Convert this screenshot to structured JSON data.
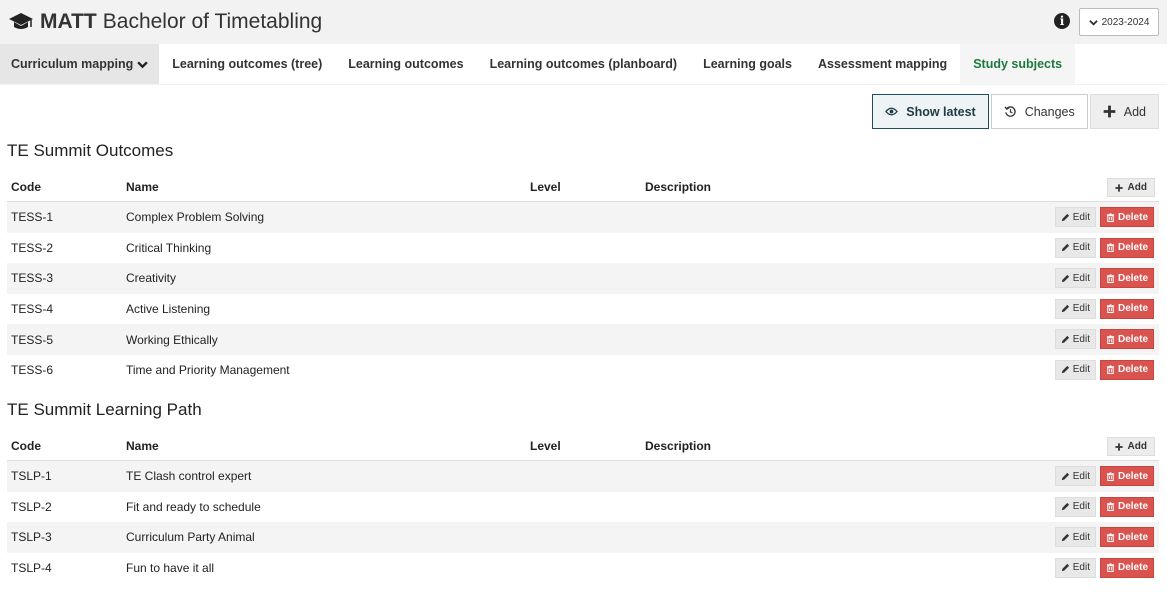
{
  "header": {
    "brand_bold": "MATT",
    "brand_rest": "Bachelor of Timetabling",
    "year": "2023-2024"
  },
  "tabs": [
    {
      "label": "Curriculum mapping"
    },
    {
      "label": "Learning outcomes (tree)"
    },
    {
      "label": "Learning outcomes"
    },
    {
      "label": "Learning outcomes (planboard)"
    },
    {
      "label": "Learning goals"
    },
    {
      "label": "Assessment mapping"
    },
    {
      "label": "Study subjects"
    }
  ],
  "toolbar": {
    "show_latest": "Show latest",
    "changes": "Changes",
    "add": "Add"
  },
  "columns": {
    "code": "Code",
    "name": "Name",
    "level": "Level",
    "description": "Description",
    "add": "Add",
    "edit": "Edit",
    "delete": "Delete"
  },
  "sections": [
    {
      "title": "TE Summit Outcomes",
      "rows": [
        {
          "code": "TESS-1",
          "name": "Complex Problem Solving"
        },
        {
          "code": "TESS-2",
          "name": "Critical Thinking"
        },
        {
          "code": "TESS-3",
          "name": "Creativity"
        },
        {
          "code": "TESS-4",
          "name": "Active Listening"
        },
        {
          "code": "TESS-5",
          "name": "Working Ethically"
        },
        {
          "code": "TESS-6",
          "name": "Time and Priority Management"
        }
      ]
    },
    {
      "title": "TE Summit Learning Path",
      "rows": [
        {
          "code": "TSLP-1",
          "name": "TE Clash control expert"
        },
        {
          "code": "TSLP-2",
          "name": "Fit and ready to schedule"
        },
        {
          "code": "TSLP-3",
          "name": "Curriculum Party Animal"
        },
        {
          "code": "TSLP-4",
          "name": "Fun to have it all"
        }
      ]
    }
  ],
  "colors": {
    "active_tab_text": "#1e7a3c",
    "delete": "#d9534f",
    "show_latest_border": "#1f4e5f"
  }
}
